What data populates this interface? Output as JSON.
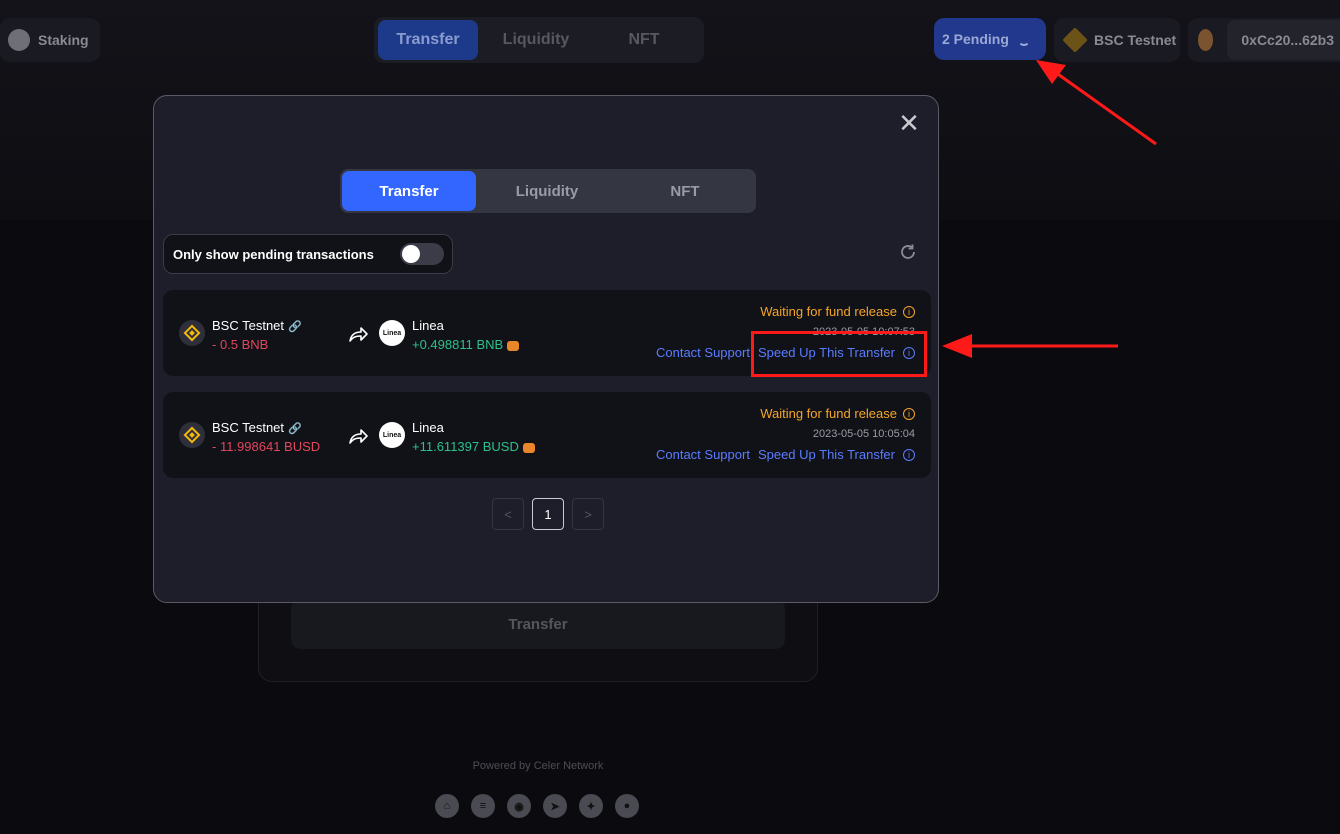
{
  "topbar": {
    "staking_label": "Staking",
    "tabs": [
      {
        "label": "Transfer",
        "active": true
      },
      {
        "label": "Liquidity",
        "active": false
      },
      {
        "label": "NFT",
        "active": false
      }
    ],
    "pending_label": "2 Pending",
    "chain_label": "BSC Testnet",
    "wallet_address": "0xCc20...62b3"
  },
  "background": {
    "transfer_button": "Transfer",
    "powered_by": "Powered by Celer Network",
    "social_icons": [
      "home-icon",
      "docs-icon",
      "discord-icon",
      "telegram-icon",
      "twitter-icon",
      "github-icon"
    ]
  },
  "modal": {
    "tabs": [
      {
        "label": "Transfer",
        "active": true
      },
      {
        "label": "Liquidity",
        "active": false
      },
      {
        "label": "NFT",
        "active": false
      }
    ],
    "toggle_label": "Only show pending transactions",
    "toggle_on": false,
    "transactions": [
      {
        "from_chain": "BSC Testnet",
        "from_amount": "- 0.5 BNB",
        "to_chain": "Linea",
        "to_amount": "+0.498811 BNB",
        "status": "Waiting for fund release",
        "time": "2023-05-05 10:07:53",
        "contact": "Contact Support",
        "speed_up": "Speed Up This Transfer"
      },
      {
        "from_chain": "BSC Testnet",
        "from_amount": "- 11.998641 BUSD",
        "to_chain": "Linea",
        "to_amount": "+11.611397 BUSD",
        "status": "Waiting for fund release",
        "time": "2023-05-05 10:05:04",
        "contact": "Contact Support",
        "speed_up": "Speed Up This Transfer"
      }
    ],
    "pagination": {
      "prev": "<",
      "current": "1",
      "next": ">"
    }
  },
  "colors": {
    "accent": "#3366ff",
    "status_orange": "#f4a52a",
    "negative": "#e0465c",
    "positive": "#2cc08b",
    "link": "#5a7cff",
    "annotation_red": "#ff1a1a"
  }
}
